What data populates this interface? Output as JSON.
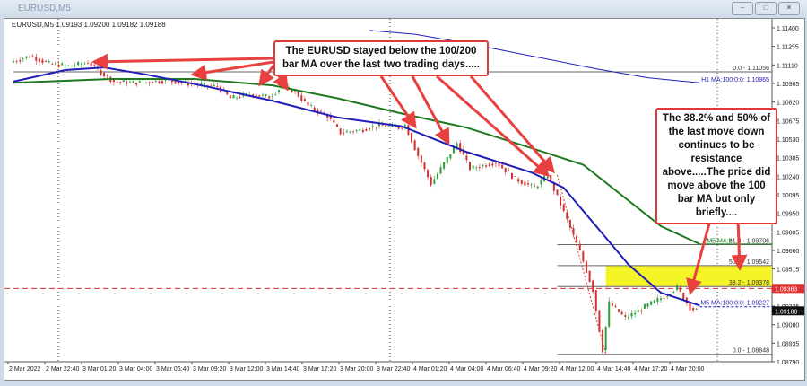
{
  "window": {
    "title": "EURUSD,M5",
    "buttons": [
      "minimize",
      "restore",
      "close"
    ]
  },
  "chart_data": {
    "type": "candlestick",
    "symbol_info": "EURUSD,M5  1.09193 1.09200 1.09182 1.09188",
    "ylim": [
      1.0879,
      1.114
    ],
    "y_ticks": [
      "1.11400",
      "1.11255",
      "1.11110",
      "1.10965",
      "1.10820",
      "1.10675",
      "1.10530",
      "1.10385",
      "1.10240",
      "1.10095",
      "1.09950",
      "1.09805",
      "1.09660",
      "1.09515",
      "1.09225",
      "1.09080",
      "1.08935",
      "1.08790"
    ],
    "x_ticks": [
      "2 Mar 2022",
      "2 Mar 22:40",
      "3 Mar 01:20",
      "3 Mar 04:00",
      "3 Mar 06:40",
      "3 Mar 09:20",
      "3 Mar 12:00",
      "3 Mar 14:40",
      "3 Mar 17:20",
      "3 Mar 20:00",
      "3 Mar 22:40",
      "4 Mar 01:20",
      "4 Mar 04:00",
      "4 Mar 06:40",
      "4 Mar 09:20",
      "4 Mar 12:00",
      "4 Mar 14:40",
      "4 Mar 17:20",
      "4 Mar 20:00"
    ],
    "price_path": [
      [
        0,
        1.1113
      ],
      [
        3,
        1.1118
      ],
      [
        6,
        1.1112
      ],
      [
        9,
        1.111
      ],
      [
        12,
        1.1113
      ],
      [
        14,
        1.1105
      ],
      [
        16,
        1.1098
      ],
      [
        20,
        1.1097
      ],
      [
        24,
        1.1099
      ],
      [
        28,
        1.1096
      ],
      [
        32,
        1.1094
      ],
      [
        34,
        1.1085
      ],
      [
        37,
        1.1088
      ],
      [
        40,
        1.1086
      ],
      [
        42,
        1.1094
      ],
      [
        44,
        1.109
      ],
      [
        46,
        1.1079
      ],
      [
        49,
        1.1071
      ],
      [
        51,
        1.1058
      ],
      [
        54,
        1.106
      ],
      [
        57,
        1.1064
      ],
      [
        60,
        1.1062
      ],
      [
        61,
        1.1064
      ],
      [
        63,
        1.104
      ],
      [
        65,
        1.1018
      ],
      [
        67,
        1.1034
      ],
      [
        69,
        1.105
      ],
      [
        71,
        1.103
      ],
      [
        75,
        1.1035
      ],
      [
        78,
        1.1022
      ],
      [
        81,
        1.1015
      ],
      [
        83,
        1.1025
      ],
      [
        85,
        1.1002
      ],
      [
        88,
        1.0965
      ],
      [
        90,
        1.0935
      ],
      [
        91.5,
        1.0888
      ],
      [
        92.5,
        1.0925
      ],
      [
        95,
        1.0913
      ],
      [
        98,
        1.0922
      ],
      [
        101,
        1.093
      ],
      [
        103,
        1.0937
      ],
      [
        105,
        1.0921
      ],
      [
        106,
        1.0919
      ]
    ],
    "ma100_path": [
      [
        0,
        1.1098
      ],
      [
        8,
        1.1107
      ],
      [
        14,
        1.1109
      ],
      [
        20,
        1.1104
      ],
      [
        30,
        1.1094
      ],
      [
        40,
        1.1083
      ],
      [
        50,
        1.107
      ],
      [
        60,
        1.1063
      ],
      [
        70,
        1.1043
      ],
      [
        80,
        1.1027
      ],
      [
        85,
        1.1015
      ],
      [
        90,
        1.0985
      ],
      [
        95,
        1.0955
      ],
      [
        100,
        1.0933
      ],
      [
        106,
        1.0923
      ]
    ],
    "ma200_path": [
      [
        0,
        1.1097
      ],
      [
        15,
        1.11
      ],
      [
        28,
        1.11
      ],
      [
        40,
        1.1095
      ],
      [
        50,
        1.1085
      ],
      [
        60,
        1.1073
      ],
      [
        70,
        1.1062
      ],
      [
        80,
        1.1046
      ],
      [
        88,
        1.1033
      ],
      [
        95,
        1.1005
      ],
      [
        100,
        1.0985
      ],
      [
        106,
        1.0971
      ]
    ],
    "h1_ma_path": [
      [
        55,
        1.1138
      ],
      [
        62,
        1.1135
      ],
      [
        70,
        1.1128
      ],
      [
        80,
        1.1118
      ],
      [
        90,
        1.1108
      ],
      [
        98,
        1.1101
      ],
      [
        106,
        1.1097
      ]
    ],
    "h1_ma_label": "H1 MA:100:0:0: 1.10965",
    "m5_ma100_label": "M5 MA:100:0:0: 1.09227",
    "m5_ma200_label": "M5 MA:2",
    "fib_levels": [
      {
        "label": "0.0 - 1.11056",
        "price": 1.11056
      },
      {
        "label": "61.8 - 1.09706",
        "price": 1.09706
      },
      {
        "label": "50.0 - 1.09542",
        "price": 1.09542
      },
      {
        "label": "38.2 - 1.09378",
        "price": 1.09378
      },
      {
        "label": "0.0 - 1.08848",
        "price": 1.08848
      }
    ],
    "bid_line": {
      "label": "1.09363",
      "price": 1.09363
    },
    "current_price": {
      "label": "1.09188",
      "price": 1.09188
    },
    "colors": {
      "ma100": "#1f1fb8",
      "ma200": "#1e7a1e",
      "h1": "#1f1fb8",
      "arrow": "#e8403f",
      "zone": "#f4f427",
      "bid": "#e03030"
    }
  },
  "annotations": {
    "left": "The EURUSD stayed below the 100/200 bar MA over the last two trading days.....",
    "right": "The 38.2% and 50% of the last move down continues to be resistance above.....The price did move above the 100 bar MA but only briefly...."
  }
}
